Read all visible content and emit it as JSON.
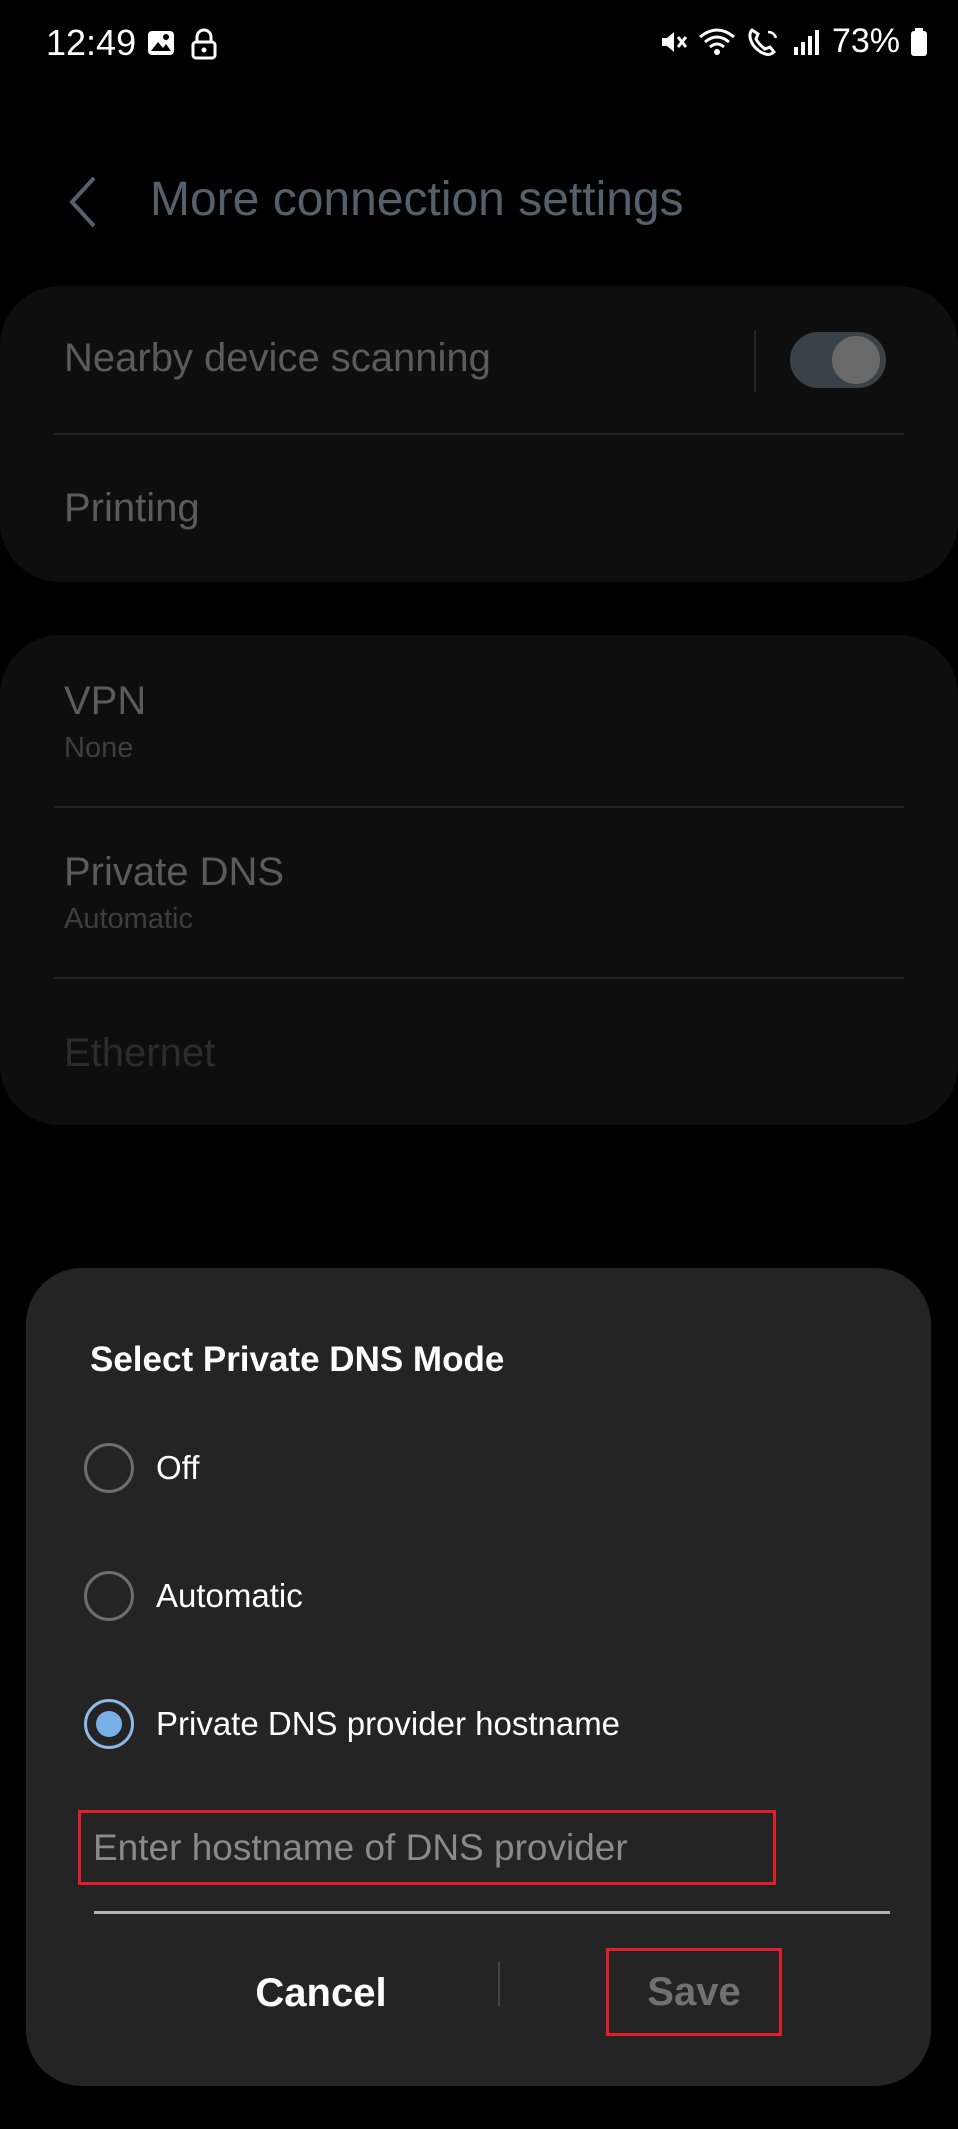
{
  "status_bar": {
    "time": "12:49",
    "battery": "73%",
    "icons": [
      "image-icon",
      "lock-icon",
      "mute-icon",
      "wifi-icon",
      "wifi-calling-icon",
      "signal-icon",
      "battery-icon"
    ]
  },
  "header": {
    "title": "More connection settings"
  },
  "card1": {
    "nearby": {
      "title": "Nearby device scanning",
      "toggle_on": true
    },
    "printing": {
      "title": "Printing"
    }
  },
  "card2": {
    "vpn": {
      "title": "VPN",
      "subtitle": "None"
    },
    "private_dns": {
      "title": "Private DNS",
      "subtitle": "Automatic"
    },
    "ethernet": {
      "title": "Ethernet"
    }
  },
  "dialog": {
    "title": "Select Private DNS Mode",
    "options": [
      {
        "label": "Off",
        "selected": false
      },
      {
        "label": "Automatic",
        "selected": false
      },
      {
        "label": "Private DNS provider hostname",
        "selected": true
      }
    ],
    "hostname_placeholder": "Enter hostname of DNS provider",
    "hostname_value": "",
    "cancel_label": "Cancel",
    "save_label": "Save"
  },
  "colors": {
    "accent": "#7ab0e8",
    "highlight": "#e01e2e"
  }
}
